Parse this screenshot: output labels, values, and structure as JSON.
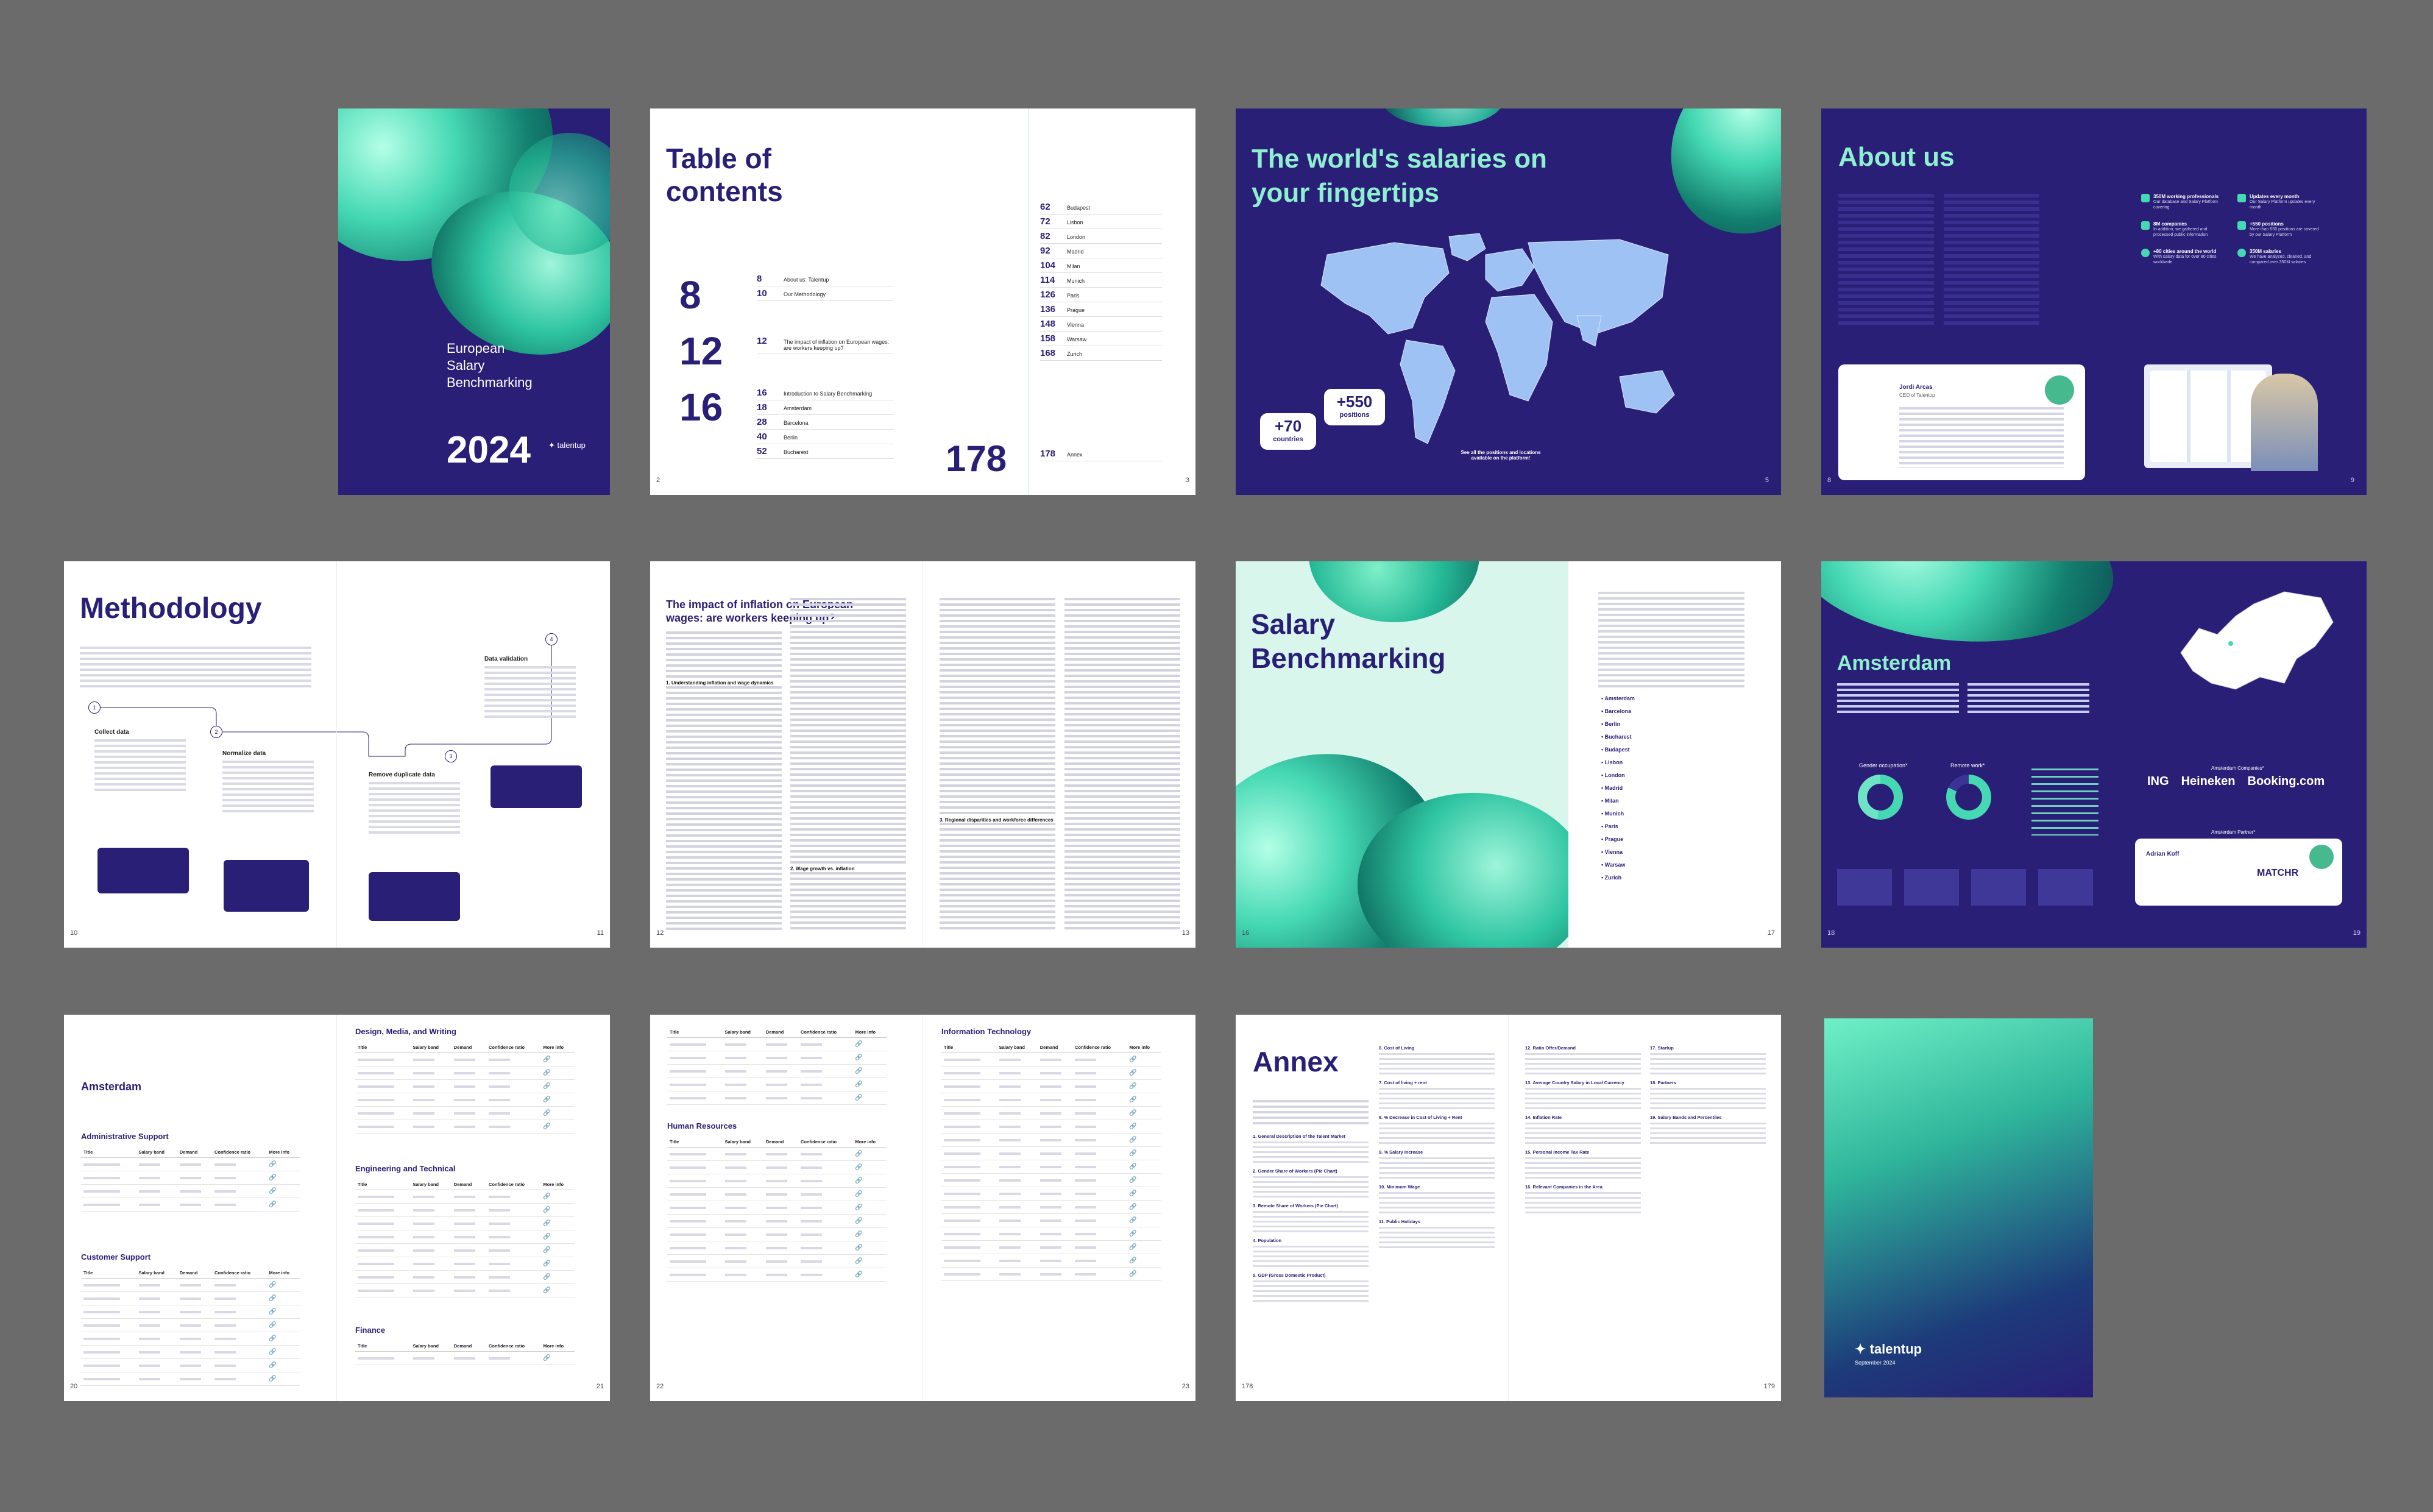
{
  "cover": {
    "title_line1": "European",
    "title_line2": "Salary",
    "title_line3": "Benchmarking",
    "year": "2024",
    "brand": "talentup"
  },
  "toc": {
    "title_line1": "Table of",
    "title_line2": "contents",
    "big_numbers": [
      "8",
      "12",
      "16"
    ],
    "group1": [
      {
        "n": "8",
        "label": "About us: Talentup"
      },
      {
        "n": "10",
        "label": "Our Methodology"
      }
    ],
    "group2": [
      {
        "n": "12",
        "label": "The impact of inflation on European wages: are workers keeping up?"
      }
    ],
    "group3": [
      {
        "n": "16",
        "label": "Introduction to Salary Benchmarking"
      },
      {
        "n": "18",
        "label": "Amsterdam"
      },
      {
        "n": "28",
        "label": "Barcelona"
      },
      {
        "n": "40",
        "label": "Berlin"
      },
      {
        "n": "52",
        "label": "Bucharest"
      }
    ],
    "right": [
      {
        "n": "62",
        "label": "Budapest"
      },
      {
        "n": "72",
        "label": "Lisbon"
      },
      {
        "n": "82",
        "label": "London"
      },
      {
        "n": "92",
        "label": "Madrid"
      },
      {
        "n": "104",
        "label": "Milan"
      },
      {
        "n": "114",
        "label": "Munich"
      },
      {
        "n": "126",
        "label": "Paris"
      },
      {
        "n": "136",
        "label": "Prague"
      },
      {
        "n": "148",
        "label": "Vienna"
      },
      {
        "n": "158",
        "label": "Warsaw"
      },
      {
        "n": "168",
        "label": "Zurich"
      }
    ],
    "big_178": "178",
    "annex_n": "178",
    "annex_label": "Annex",
    "page_left": "2",
    "page_right": "3"
  },
  "world": {
    "title_line1": "The world's salaries on",
    "title_line2": "your fingertips",
    "badge1_value": "+70",
    "badge1_label": "countries",
    "badge2_value": "+550",
    "badge2_label": "positions",
    "note": "See all the positions and locations available on the platform!",
    "page": "5"
  },
  "about": {
    "title": "About us",
    "stats": [
      {
        "value": "350M working professionals",
        "text": "Our database and Salary Platform covering"
      },
      {
        "value": "Updates every month",
        "text": "Our Salary Platform updates every month"
      },
      {
        "value": "8M companies",
        "text": "In addition, we gathered and processed public information"
      },
      {
        "value": "+550 positions",
        "text": "More than 550 positions are covered by our Salary Platform"
      },
      {
        "value": "+80 cities around the world",
        "text": "With salary data for over 80 cities worldwide"
      },
      {
        "value": "350M salaries",
        "text": "We have analyzed, cleaned, and compared over 350M salaries"
      }
    ],
    "quote_name": "Jordi Arcas",
    "quote_role": "CEO of Talentup",
    "page_left": "8",
    "page_right": "9"
  },
  "methodology": {
    "title": "Methodology",
    "steps": [
      {
        "n": "1",
        "title": "Collect data"
      },
      {
        "n": "2",
        "title": "Normalize data"
      },
      {
        "n": "3",
        "title": "Remove duplicate data"
      },
      {
        "n": "4",
        "title": "Data validation"
      }
    ],
    "page_left": "10",
    "page_right": "11"
  },
  "inflation": {
    "title_line1": "The impact of inflation on European",
    "title_line2": "wages: are workers keeping up?",
    "section1": "1. Understanding inflation and wage dynamics",
    "section2": "2. Wage growth vs. inflation",
    "section3": "3. Regional disparities and workforce differences",
    "page_left": "12",
    "page_right": "13"
  },
  "benchmarking": {
    "title_line1": "Salary",
    "title_line2": "Benchmarking",
    "cities": [
      "Amsterdam",
      "Barcelona",
      "Berlin",
      "Bucharest",
      "Budapest",
      "Lisbon",
      "London",
      "Madrid",
      "Milan",
      "Munich",
      "Paris",
      "Prague",
      "Vienna",
      "Warsaw",
      "Zurich"
    ],
    "page_left": "16",
    "page_right": "17"
  },
  "amsterdam": {
    "title": "Amsterdam",
    "donut1_label": "Gender occupation*",
    "donut2_label": "Remote work*",
    "companies_label": "Amsterdam Companies*",
    "companies": [
      "ING",
      "Heineken",
      "Booking.com"
    ],
    "partner_label": "Amsterdam Partner*",
    "partner_name": "Adrian Koff",
    "partner_brand": "MATCHR",
    "page_left": "18",
    "page_right": "19"
  },
  "tables_a": {
    "city": "Amsterdam",
    "sections": [
      {
        "title": "Administrative Support",
        "rows": 4
      },
      {
        "title": "Customer Support",
        "rows": 8
      }
    ],
    "right_sections": [
      {
        "title": "Design, Media, and Writing",
        "rows": 6
      },
      {
        "title": "Engineering and Technical",
        "rows": 8
      },
      {
        "title": "Finance",
        "rows": 1
      }
    ],
    "headers": [
      "Title",
      "Salary band",
      "Demand",
      "Confidence ratio",
      "More info"
    ],
    "page_left": "20",
    "page_right": "21"
  },
  "tables_b": {
    "left_sections": [
      {
        "title": "Human Resources",
        "rows": 10
      }
    ],
    "right_sections": [
      {
        "title": "Information Technology",
        "rows": 17
      }
    ],
    "headers": [
      "Title",
      "Salary band",
      "Demand",
      "Confidence ratio",
      "More info"
    ],
    "page_left": "22",
    "page_right": "23"
  },
  "annex": {
    "title": "Annex",
    "items": [
      {
        "n": "1.",
        "title": "General Description of the Talent Market"
      },
      {
        "n": "2.",
        "title": "Gender Share of Workers (Pie Chart)"
      },
      {
        "n": "3.",
        "title": "Remote Share of Workers (Pie Chart)"
      },
      {
        "n": "4.",
        "title": "Population"
      },
      {
        "n": "5.",
        "title": "GDP (Gross Domestic Product)"
      },
      {
        "n": "6.",
        "title": "Cost of Living"
      },
      {
        "n": "7.",
        "title": "Cost of living + rent"
      },
      {
        "n": "8.",
        "title": "% Decrease in Cost of Living + Rent"
      },
      {
        "n": "9.",
        "title": "% Salary Increase"
      },
      {
        "n": "10.",
        "title": "Minimum Wage"
      },
      {
        "n": "11.",
        "title": "Public Holidays"
      },
      {
        "n": "12.",
        "title": "Ratio Offer/Demand"
      },
      {
        "n": "13.",
        "title": "Average Country Salary in Local Currency"
      },
      {
        "n": "14.",
        "title": "Inflation Rate"
      },
      {
        "n": "15.",
        "title": "Personal Income Tax Rate"
      },
      {
        "n": "16.",
        "title": "Relevant Companies in the Area"
      },
      {
        "n": "17.",
        "title": "Startup"
      },
      {
        "n": "18.",
        "title": "Partners"
      },
      {
        "n": "19.",
        "title": "Salary Bands and Percentiles"
      }
    ],
    "page_left": "178",
    "page_right": "179"
  },
  "back": {
    "brand": "talentup",
    "date": "September 2024"
  },
  "colors": {
    "navy": "#2a1f77",
    "mint": "#45d8b3",
    "background": "#6b6b6b"
  }
}
